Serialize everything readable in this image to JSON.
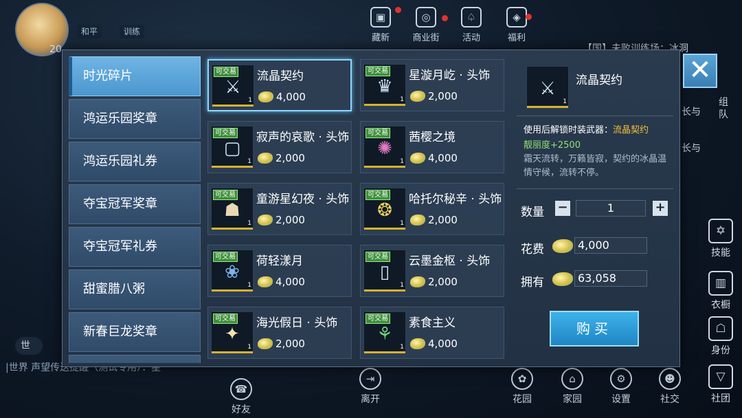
{
  "hud": {
    "level": "20",
    "tag_peace": "和平",
    "tag_train": "训练",
    "top_icons": [
      "藏新",
      "商业街",
      "活动",
      "福利"
    ],
    "top_notice": "【国】未败训练场：冰洞",
    "right_texts": [
      "长与",
      "长与"
    ],
    "right_tab": "组队",
    "world_chat": "|世界  声望传送提醒（测试专用）：星",
    "world_small": "世",
    "side_buttons": [
      "技能",
      "衣橱",
      "身份",
      "社团"
    ],
    "bottom_buttons": [
      "花园",
      "家园",
      "设置",
      "社交"
    ],
    "leave": "离开",
    "friends": "好友"
  },
  "tabs": [
    "时光碎片",
    "鸿运乐园奖章",
    "鸿运乐园礼券",
    "夺宝冠军奖章",
    "夺宝冠军礼券",
    "甜蜜腊八粥",
    "新春巨龙奖章"
  ],
  "active_tab": 0,
  "tradeable_label": "可交易",
  "items": [
    {
      "name": "流晶契约",
      "price": "4,000",
      "qty": "1",
      "icon": "sword-icon",
      "selected": true
    },
    {
      "name": "星漩月屹 · 头饰",
      "price": "2,000",
      "qty": "1",
      "icon": "mask-icon"
    },
    {
      "name": "寂声的哀歌 · 头饰",
      "price": "2,000",
      "qty": "1",
      "icon": "frame-icon"
    },
    {
      "name": "茜樱之境",
      "price": "4,000",
      "qty": "1",
      "icon": "sparkle-icon"
    },
    {
      "name": "童游星幻夜 · 头饰",
      "price": "2,000",
      "qty": "1",
      "icon": "dragon-icon"
    },
    {
      "name": "哈托尔秘辛 · 头饰",
      "price": "2,000",
      "qty": "1",
      "icon": "ornament-icon"
    },
    {
      "name": "荷轻漾月",
      "price": "4,000",
      "qty": "1",
      "icon": "lotus-icon"
    },
    {
      "name": "云墨金枢 · 头饰",
      "price": "2,000",
      "qty": "1",
      "icon": "door-icon"
    },
    {
      "name": "海光假日 · 头饰",
      "price": "2,000",
      "qty": "1",
      "icon": "shell-icon"
    },
    {
      "name": "素食主义",
      "price": "4,000",
      "qty": "1",
      "icon": "leaf-sword-icon"
    }
  ],
  "detail": {
    "name": "流晶契约",
    "qty_badge": "1",
    "line1_prefix": "使用后解锁时装武器：",
    "line1_highlight": "流晶契约",
    "line2": "靓丽度+2500",
    "line3": "霜天流转，万籁皆寂，契约的冰晶温情守候，流转不停。",
    "qty_label": "数量",
    "qty_value": "1",
    "minus": "−",
    "plus": "+",
    "cost_label": "花费",
    "cost_value": "4,000",
    "own_label": "拥有",
    "own_value": "63,058",
    "buy_label": "购买"
  },
  "close_label": "✕"
}
